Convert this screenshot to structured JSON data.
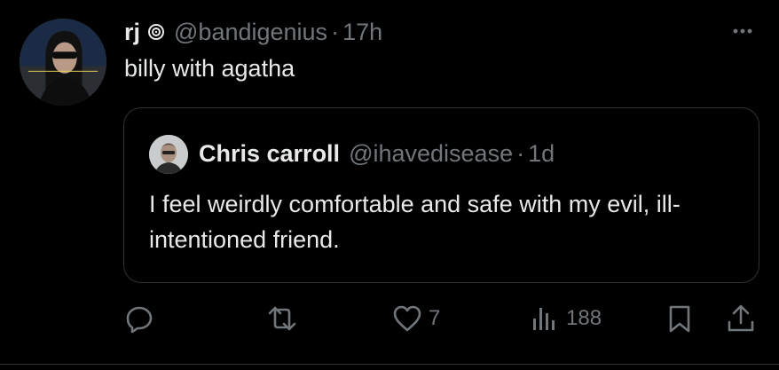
{
  "tweet": {
    "display_name": "rj",
    "handle": "@bandigenius",
    "separator": "·",
    "time": "17h",
    "text": "billy with agatha"
  },
  "quoted_tweet": {
    "display_name": "Chris carroll",
    "handle": "@ihavedisease",
    "separator": "·",
    "time": "1d",
    "text": "I feel weirdly comfortable and safe with my evil, ill-intentioned friend."
  },
  "actions": {
    "reply": {
      "icon": "reply-icon"
    },
    "repost": {
      "icon": "repost-icon"
    },
    "like": {
      "icon": "heart-icon",
      "count": "7"
    },
    "views": {
      "icon": "views-icon",
      "count": "188"
    },
    "bookmark": {
      "icon": "bookmark-icon"
    },
    "share": {
      "icon": "share-icon"
    }
  },
  "colors": {
    "background": "#000000",
    "primary_text": "#e7e9ea",
    "secondary_text": "#71767b",
    "border": "#2f3336"
  }
}
